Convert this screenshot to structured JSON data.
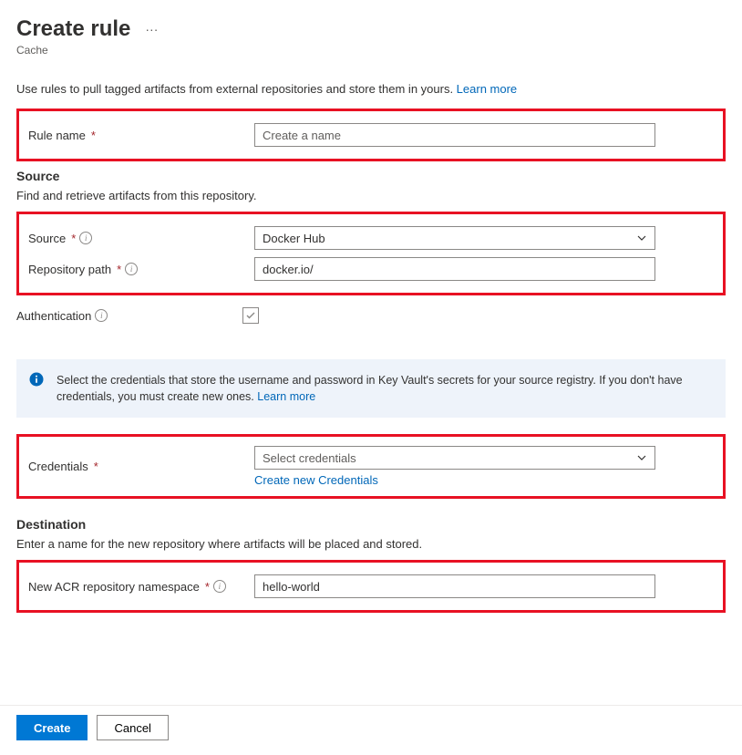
{
  "header": {
    "title": "Create rule",
    "context": "Cache"
  },
  "intro": {
    "text": "Use rules to pull tagged artifacts from external repositories and store them in yours. ",
    "learn_more": "Learn more"
  },
  "fields": {
    "rule_name": {
      "label": "Rule name",
      "placeholder": "Create a name",
      "value": ""
    },
    "source_section": {
      "title": "Source",
      "desc": "Find and retrieve artifacts from this repository."
    },
    "source": {
      "label": "Source",
      "value": "Docker Hub"
    },
    "repo_path": {
      "label": "Repository path",
      "value": "docker.io/"
    },
    "auth": {
      "label": "Authentication",
      "checked": true
    },
    "banner": {
      "text": "Select the credentials that store the username and password in Key Vault's secrets for your source registry. If you don't have credentials, you must create new ones. ",
      "learn_more": "Learn more"
    },
    "credentials": {
      "label": "Credentials",
      "placeholder": "Select credentials",
      "create_link": "Create new Credentials"
    },
    "dest_section": {
      "title": "Destination",
      "desc": "Enter a name for the new repository where artifacts will be placed and stored."
    },
    "dest_ns": {
      "label": "New ACR repository namespace",
      "value": "hello-world"
    }
  },
  "footer": {
    "create": "Create",
    "cancel": "Cancel"
  }
}
